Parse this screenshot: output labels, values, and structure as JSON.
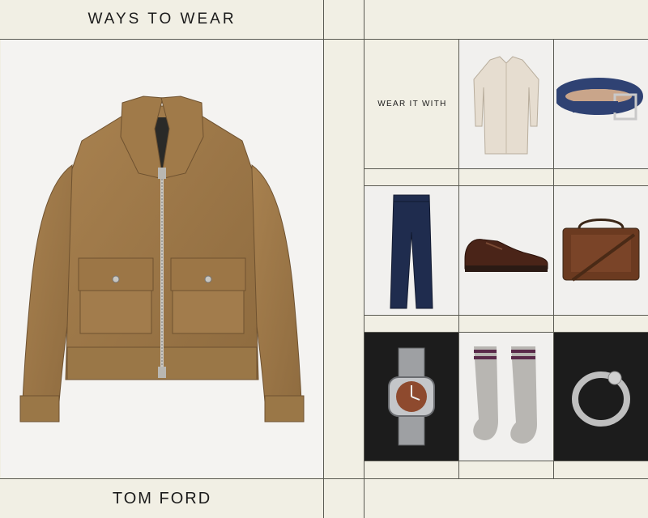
{
  "header": {
    "title": "WAYS TO WEAR"
  },
  "footer": {
    "brand": "TOM FORD"
  },
  "grid": {
    "label": "WEAR IT WITH"
  },
  "hero": {
    "item": "suede-jacket"
  },
  "products": [
    {
      "name": "shirt"
    },
    {
      "name": "belt"
    },
    {
      "name": "trousers"
    },
    {
      "name": "derby-shoes"
    },
    {
      "name": "leather-bag"
    },
    {
      "name": "watch"
    },
    {
      "name": "socks"
    },
    {
      "name": "ring"
    }
  ],
  "colors": {
    "background": "#f1efe4",
    "lines": "#5a5a52",
    "jacket": "#a27c4f",
    "navy": "#1f2c4e"
  }
}
